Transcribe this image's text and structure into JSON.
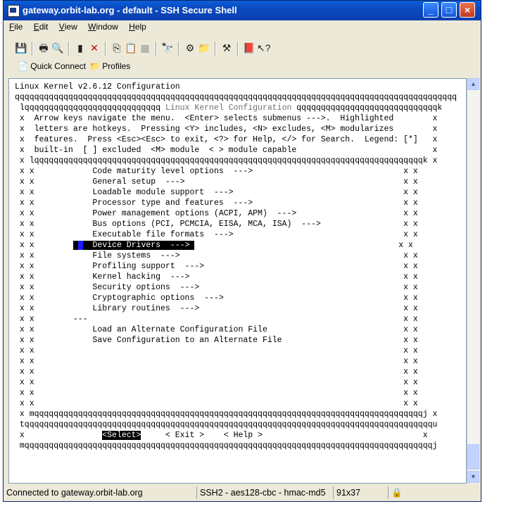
{
  "window": {
    "title": "gateway.orbit-lab.org - default - SSH Secure Shell"
  },
  "titlebar_buttons": {
    "minimize": "_",
    "maximize": "□",
    "close": "×"
  },
  "menu": [
    {
      "label": "File",
      "key": "F",
      "rest": "ile"
    },
    {
      "label": "Edit",
      "key": "E",
      "rest": "dit"
    },
    {
      "label": "View",
      "key": "V",
      "rest": "iew"
    },
    {
      "label": "Window",
      "key": "W",
      "rest": "indow"
    },
    {
      "label": "Help",
      "key": "H",
      "rest": "elp"
    }
  ],
  "toolbar": {
    "icons": [
      "save-icon",
      "print-icon",
      "print-preview-icon",
      "disconnect-icon",
      "disconnect-red-icon",
      "copy-icon",
      "paste-icon",
      "paste-clipboard-icon",
      "find-icon",
      "settings-icon",
      "profile-settings-icon",
      "tools-icon",
      "help-book-icon",
      "whats-this-icon"
    ]
  },
  "toolbar2": {
    "quick_connect": "Quick Connect",
    "profiles": "Profiles"
  },
  "terminal": {
    "lines": [
      "Linux Kernel v2.6.12 Configuration",
      "qqqqqqqqqqqqqqqqqqqqqqqqqqqqqqqqqqqqqqqqqqqqqqqqqqqqqqqqqqqqqqqqqqqqqqqqqqqqqqqqqqqqqqqqqqq",
      " lqqqqqqqqqqqqqqqqqqqqqqqqqqqq Linux Kernel Configuration qqqqqqqqqqqqqqqqqqqqqqqqqqqqqk",
      " x  Arrow keys navigate the menu.  <Enter> selects submenus --->.  Highlighted        x",
      " x  letters are hotkeys.  Pressing <Y> includes, <N> excludes, <M> modularizes        x",
      " x  features.  Press <Esc><Esc> to exit, <?> for Help, </> for Search.  Legend: [*]   x",
      " x  built-in  [ ] excluded  <M> module  < > module capable                            x",
      " x lqqqqqqqqqqqqqqqqqqqqqqqqqqqqqqqqqqqqqqqqqqqqqqqqqqqqqqqqqqqqqqqqqqqqqqqqqqqqqqqqk x",
      " x x            Code maturity level options  --->                               x x",
      " x x            General setup  --->                                             x x",
      " x x            Loadable module support  --->                                   x x",
      " x x            Processor type and features  --->                               x x",
      " x x            Power management options (ACPI, APM)  --->                      x x",
      " x x            Bus options (PCI, PCMCIA, EISA, MCA, ISA)  --->                 x x",
      " x x            Executable file formats  --->                                   x x",
      " x x        HL                                                                  x x",
      " x x            File systems  --->                                              x x",
      " x x            Profiling support  --->                                         x x",
      " x x            Kernel hacking  --->                                            x x",
      " x x            Security options  --->                                          x x",
      " x x            Cryptographic options  --->                                     x x",
      " x x            Library routines  --->                                          x x",
      " x x        ---                                                                 x x",
      " x x            Load an Alternate Configuration File                            x x",
      " x x            Save Configuration to an Alternate File                         x x",
      " x x                                                                            x x",
      " x x                                                                            x x",
      " x x                                                                            x x",
      " x x                                                                            x x",
      " x x                                                                            x x",
      " x x                                                                            x x",
      " x mqqqqqqqqqqqqqqqqqqqqqqqqqqqqqqqqqqqqqqqqqqqqqqqqqqqqqqqqqqqqqqqqqqqqqqqqqqqqqqqqj x",
      " tqqqqqqqqqqqqqqqqqqqqqqqqqqqqqqqqqqqqqqqqqqqqqqqqqqqqqqqqqqqqqqqqqqqqqqqqqqqqqqqqqqqqu",
      " x                     BTN     < Exit >    < Help >                                 x",
      " mqqqqqqqqqqqqqqqqqqqqqqqqqqqqqqqqqqqqqqqqqqqqqqqqqqqqqqqqqqqqqqqqqqqqqqqqqqqqqqqqqqqqj"
    ],
    "highlighted_item": "Device Drivers  --->",
    "select_button": "<Select>"
  },
  "status": {
    "connection": "Connected to gateway.orbit-lab.org",
    "cipher": "SSH2 - aes128-cbc - hmac-md5",
    "size": "91x37"
  }
}
